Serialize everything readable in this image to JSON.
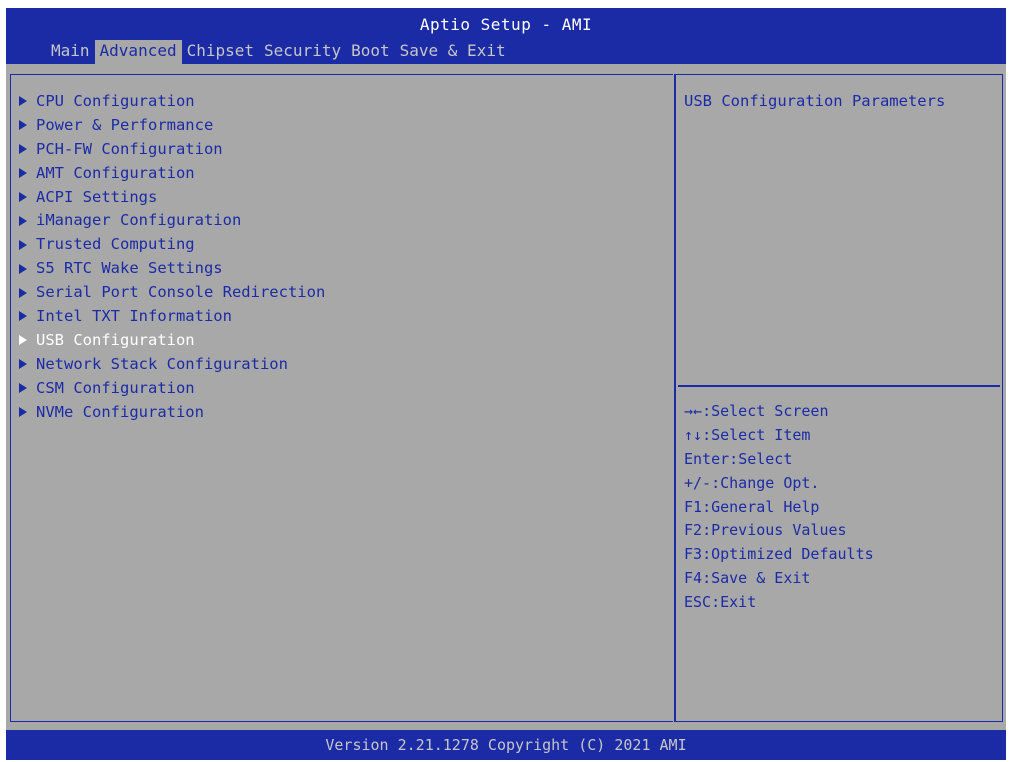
{
  "app": {
    "title": "Aptio Setup - AMI",
    "version": "Version 2.21.1278 Copyright (C) 2021 AMI"
  },
  "tabs": [
    {
      "label": "Main",
      "active": false
    },
    {
      "label": "Advanced",
      "active": true
    },
    {
      "label": "Chipset",
      "active": false
    },
    {
      "label": "Security",
      "active": false
    },
    {
      "label": "Boot",
      "active": false
    },
    {
      "label": "Save & Exit",
      "active": false
    }
  ],
  "menu_items": [
    {
      "label": "CPU Configuration",
      "selected": false,
      "icon": "submenu-arrow-icon"
    },
    {
      "label": "Power & Performance",
      "selected": false,
      "icon": "submenu-arrow-icon"
    },
    {
      "label": "PCH-FW Configuration",
      "selected": false,
      "icon": "submenu-arrow-icon"
    },
    {
      "label": "AMT Configuration",
      "selected": false,
      "icon": "submenu-arrow-icon"
    },
    {
      "label": "ACPI Settings",
      "selected": false,
      "icon": "submenu-arrow-icon"
    },
    {
      "label": "iManager Configuration",
      "selected": false,
      "icon": "submenu-arrow-icon"
    },
    {
      "label": "Trusted Computing",
      "selected": false,
      "icon": "submenu-arrow-icon"
    },
    {
      "label": "S5 RTC Wake Settings",
      "selected": false,
      "icon": "submenu-arrow-icon"
    },
    {
      "label": "Serial Port Console Redirection",
      "selected": false,
      "icon": "submenu-arrow-icon"
    },
    {
      "label": "Intel TXT Information",
      "selected": false,
      "icon": "submenu-arrow-icon"
    },
    {
      "label": "USB Configuration",
      "selected": true,
      "icon": "submenu-arrow-icon"
    },
    {
      "label": "Network Stack Configuration",
      "selected": false,
      "icon": "submenu-arrow-icon"
    },
    {
      "label": "CSM Configuration",
      "selected": false,
      "icon": "submenu-arrow-icon"
    },
    {
      "label": "NVMe Configuration",
      "selected": false,
      "icon": "submenu-arrow-icon"
    }
  ],
  "help": {
    "description": "USB Configuration Parameters",
    "keys": [
      {
        "key": "→←",
        "action": "Select Screen"
      },
      {
        "key": "↑↓",
        "action": "Select Item"
      },
      {
        "key": "Enter",
        "action": "Select"
      },
      {
        "key": "+/-",
        "action": "Change Opt."
      },
      {
        "key": "F1",
        "action": "General Help"
      },
      {
        "key": "F2",
        "action": "Previous Values"
      },
      {
        "key": "F3",
        "action": "Optimized Defaults"
      },
      {
        "key": "F4",
        "action": "Save & Exit"
      },
      {
        "key": "ESC",
        "action": "Exit"
      }
    ]
  },
  "colors": {
    "bar_blue": "#1b2ba6",
    "panel_gray": "#a8a8a8",
    "text_blue": "#1b2ba6",
    "highlight_white": "#ffffff",
    "inactive_tab": "#c6c6c6"
  }
}
